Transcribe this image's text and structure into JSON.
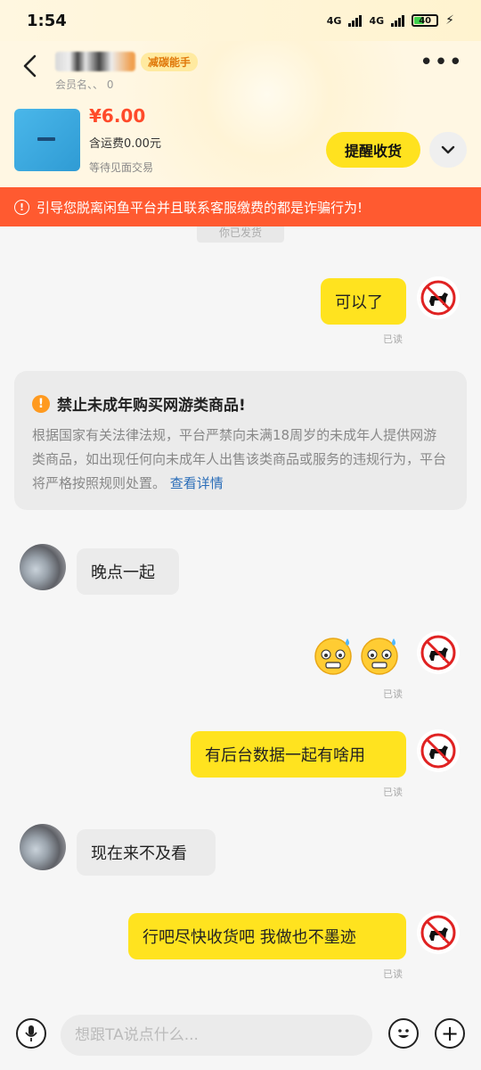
{
  "status_bar": {
    "time": "1:54",
    "network_1": "4G",
    "network_2": "4G",
    "battery": "40",
    "charge_icon": "lightning-icon"
  },
  "header": {
    "badge": "减碳能手",
    "member_text": "会员名、、 0",
    "more_label": "•••"
  },
  "product": {
    "price": "¥6.00",
    "shipping": "含运费0.00元",
    "trade_status": "等待见面交易",
    "remind_button": "提醒收货"
  },
  "warning": {
    "text": "引导您脱离闲鱼平台并且联系客服缴费的都是诈骗行为!"
  },
  "system_message_partial": "你已发货",
  "notice": {
    "title": "禁止未成年购买网游类商品!",
    "body": "根据国家有关法律法规，平台严禁向未满18周岁的未成年人提供网游类商品，如出现任何向未成年人出售该类商品或服务的违规行为，平台将严格按照规则处置。",
    "link": "查看详情"
  },
  "messages": [
    {
      "side": "mine",
      "text": "可以了",
      "status": "已读"
    },
    {
      "side": "theirs",
      "text": "晚点一起"
    },
    {
      "side": "mine",
      "type": "emoji",
      "emoji": "anxious-sweat-face",
      "count": 2,
      "status": "已读"
    },
    {
      "side": "mine",
      "text": "有后台数据一起有啥用",
      "status": "已读"
    },
    {
      "side": "theirs",
      "text": "现在来不及看"
    },
    {
      "side": "mine",
      "text": "行吧尽快收货吧 我做也不墨迹",
      "status": "已读"
    }
  ],
  "input_bar": {
    "placeholder": "想跟TA说点什么...",
    "plus_label": "+"
  },
  "colors": {
    "accent_yellow": "#ffe21f",
    "warning_red": "#ff5a30",
    "price_red": "#ff4a2a",
    "link_blue": "#2a6db8"
  }
}
